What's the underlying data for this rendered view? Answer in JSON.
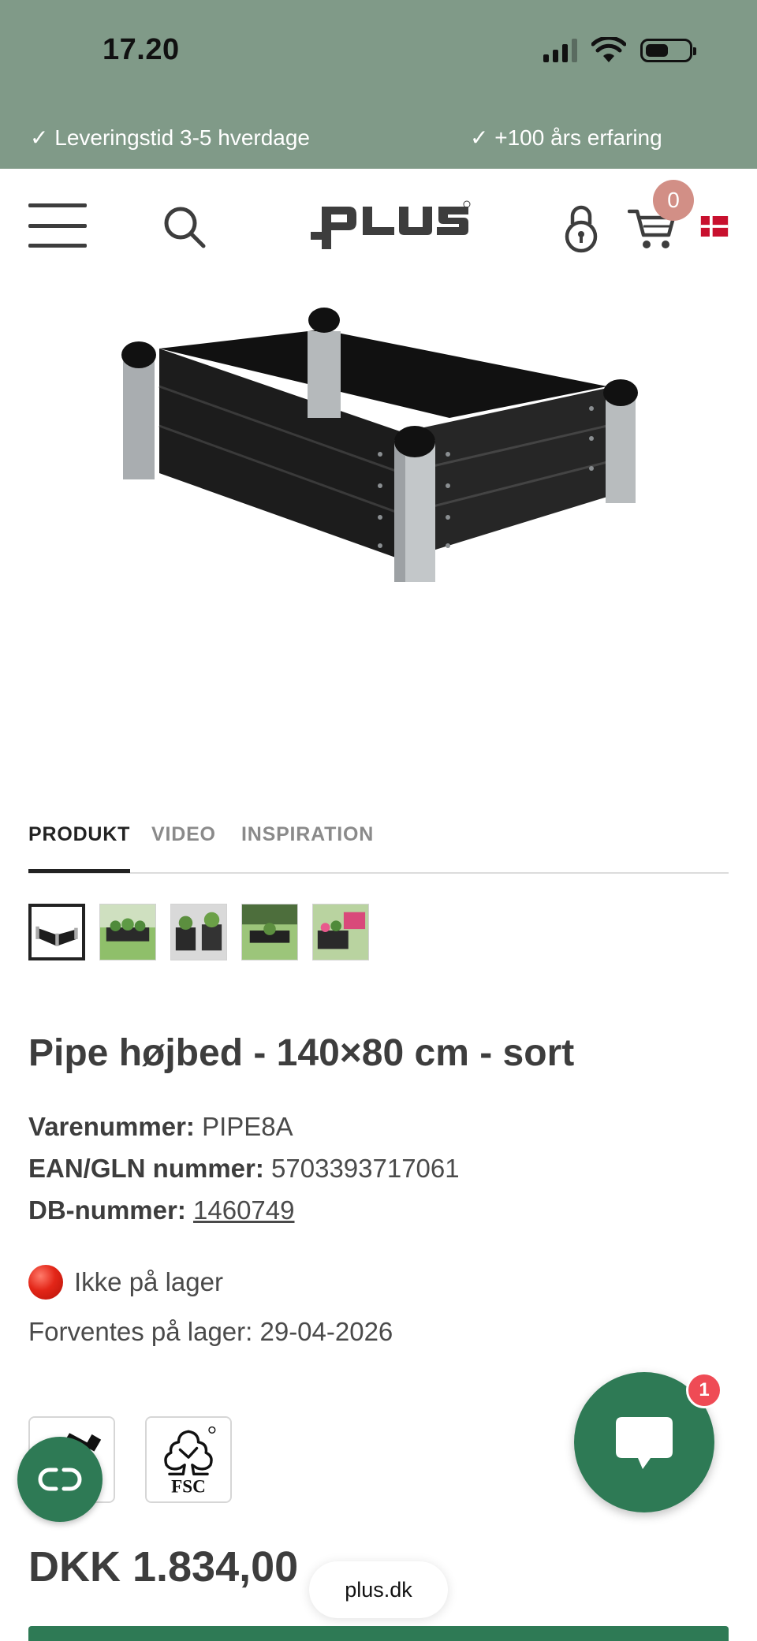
{
  "status_bar": {
    "time": "17.20"
  },
  "usp": {
    "left": "✓ Leveringstid 3-5 hverdage",
    "right": "✓ +100 års erfaring"
  },
  "header": {
    "logo_text": "PLUS",
    "cart_count": "0"
  },
  "tabs": [
    {
      "label": "PRODUKT",
      "active": true
    },
    {
      "label": "VIDEO",
      "active": false
    },
    {
      "label": "INSPIRATION",
      "active": false
    }
  ],
  "thumbnails_count": 5,
  "product": {
    "title": "Pipe højbed - 140×80 cm - sort",
    "item_number_label": "Varenummer:",
    "item_number": "PIPE8A",
    "ean_label": "EAN/GLN nummer:",
    "ean": "5703393717061",
    "db_label": "DB-nummer:",
    "db_number": "1460749",
    "stock_status": "Ikke på lager",
    "expected_stock": "Forventes på lager: 29-04-2026",
    "price": "DKK 1.834,00"
  },
  "certifications": {
    "fsc_label": "FSC"
  },
  "chat": {
    "unread_count": "1"
  },
  "browser": {
    "url": "plus.dk"
  },
  "colors": {
    "header_green": "#809a88",
    "brand_green": "#2e7a55",
    "cart_badge": "#d28f86",
    "chat_badge": "#ef4b55"
  }
}
